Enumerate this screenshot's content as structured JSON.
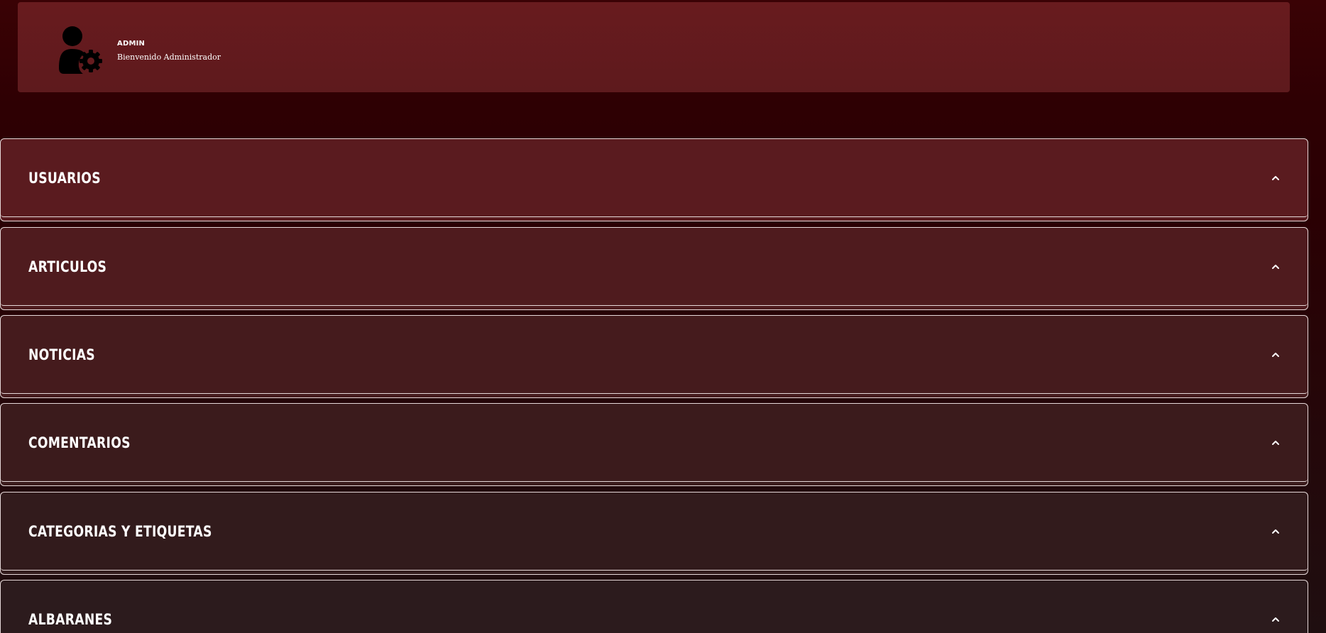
{
  "header": {
    "avatar_icon": "user-gear-icon",
    "user_name": "ADMIN",
    "greeting": "Bienvenido Administrador",
    "background_color": "#651b1e"
  },
  "accordions": [
    {
      "title": "USUARIOS",
      "icon": "chevron-up-icon",
      "bg": "#5a1b1f"
    },
    {
      "title": "ARTICULOS",
      "icon": "chevron-up-icon",
      "bg": "#4f1b1e"
    },
    {
      "title": "NOTICIAS",
      "icon": "chevron-up-icon",
      "bg": "#451b1d"
    },
    {
      "title": "COMENTARIOS",
      "icon": "chevron-up-icon",
      "bg": "#3b1b1c"
    },
    {
      "title": "CATEGORIAS Y ETIQUETAS",
      "icon": "chevron-up-icon",
      "bg": "#321b1c"
    },
    {
      "title": "ALBARANES",
      "icon": "chevron-up-icon",
      "bg": "#2c1b1d"
    }
  ],
  "colors": {
    "page_background": "#2e0003",
    "border": "#e6d9d9",
    "text": "#ffffff"
  }
}
